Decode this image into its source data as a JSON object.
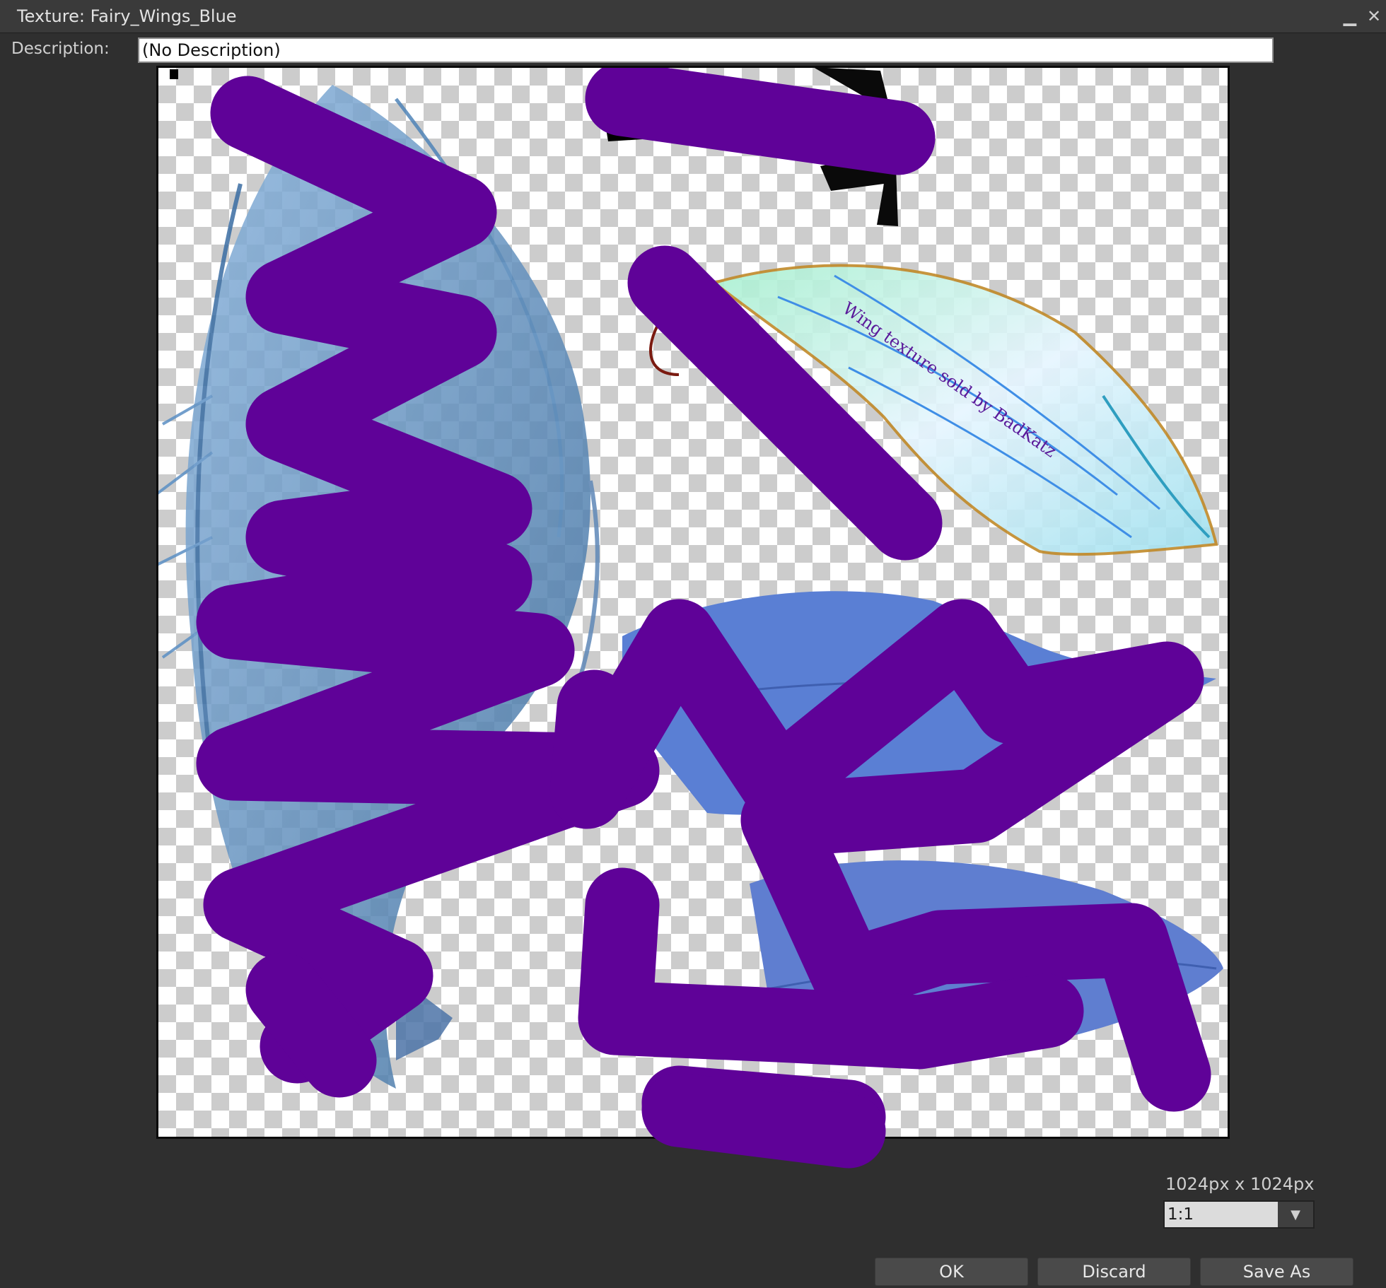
{
  "window": {
    "title": "Texture: Fairy_Wings_Blue",
    "minimize_icon": "minimize-icon",
    "close_icon": "close-icon"
  },
  "description": {
    "label": "Description:",
    "value": "(No Description)"
  },
  "preview": {
    "watermark": "Wing texture sold by BadKatz",
    "colors": {
      "scribble": "#5f0298",
      "hair": "#5d8fbf",
      "leaf": "#5a7fd4",
      "wing_fill": "#bfeede",
      "wing_veins": "#3f8ee6",
      "wing_border": "#c08a2a"
    }
  },
  "image_info": {
    "size_text": "1024px x 1024px",
    "zoom_value": "1:1",
    "dropdown_icon": "chevron-down-icon"
  },
  "buttons": {
    "ok": "OK",
    "discard": "Discard",
    "save_as": "Save As"
  }
}
